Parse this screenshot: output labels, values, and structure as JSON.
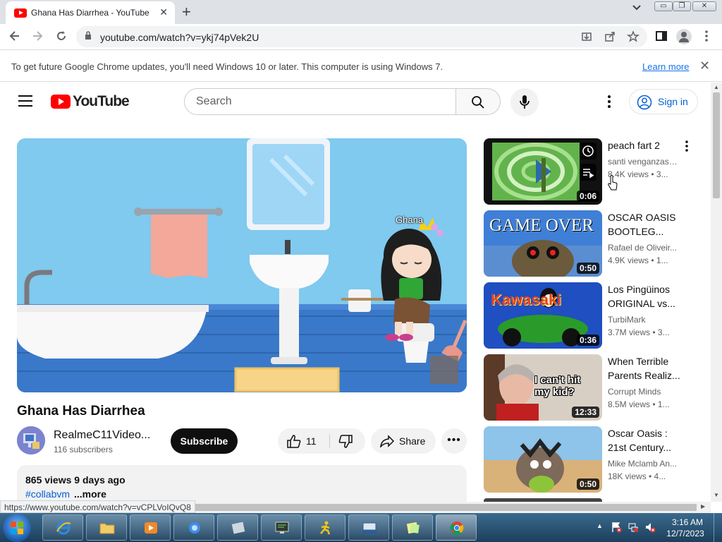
{
  "browser": {
    "tab_title": "Ghana Has Diarrhea - YouTube",
    "tab_close": "✕",
    "new_tab": "+",
    "url": "youtube.com/watch?v=ykj74pVek2U",
    "window_controls": {
      "minimize": "▭",
      "restore": "❐",
      "close": "✕"
    }
  },
  "infobar": {
    "message": "To get future Google Chrome updates, you'll need Windows 10 or later. This computer is using Windows 7.",
    "link": "Learn more",
    "close": "✕"
  },
  "youtube": {
    "logo_text": "YouTube",
    "search_placeholder": "Search",
    "sign_in": "Sign in"
  },
  "video": {
    "title": "Ghana Has Diarrhea",
    "overlay_name": "Ghana",
    "channel_name": "RealmeC11Video...",
    "subscribers": "116 subscribers",
    "subscribe_label": "Subscribe",
    "likes": "11",
    "share_label": "Share",
    "more_label": "•••",
    "views_date": "865 views  9 days ago",
    "hashtag": "#collabvm",
    "more_link": "...more"
  },
  "recommendations": [
    {
      "title": "peach fart 2",
      "channel": "santi venganzas ...",
      "meta": "8.4K views  • 3...",
      "duration": "0:06"
    },
    {
      "title": "OSCAR OASIS BOOTLEG...",
      "channel": "Rafael de Oliveir...",
      "meta": "4.9K views  • 1...",
      "duration": "0:50",
      "thumb_text": "GAME OVER"
    },
    {
      "title": "Los Pingüinos ORIGINAL vs...",
      "channel": "TurbiMark",
      "meta": "3.7M views  • 3...",
      "duration": "0:36",
      "thumb_text": "Kawasaki"
    },
    {
      "title": "When Terrible Parents Realiz...",
      "channel": "Corrupt Minds",
      "meta": "8.5M views  • 1...",
      "duration": "12:33",
      "thumb_text": "I can't hit my kid?"
    },
    {
      "title": "Oscar Oasis : 21st Century...",
      "channel": "Mike Mclamb An...",
      "meta": "18K views  • 4...",
      "duration": "0:50"
    }
  ],
  "status_url": "https://www.youtube.com/watch?v=vCPLVoIQvQ8",
  "taskbar": {
    "time": "3:16 AM",
    "date": "12/7/2023"
  },
  "colors": {
    "yt_red": "#ff0000",
    "link_blue": "#065fd4",
    "chrome_tabstrip": "#dee1e6"
  }
}
